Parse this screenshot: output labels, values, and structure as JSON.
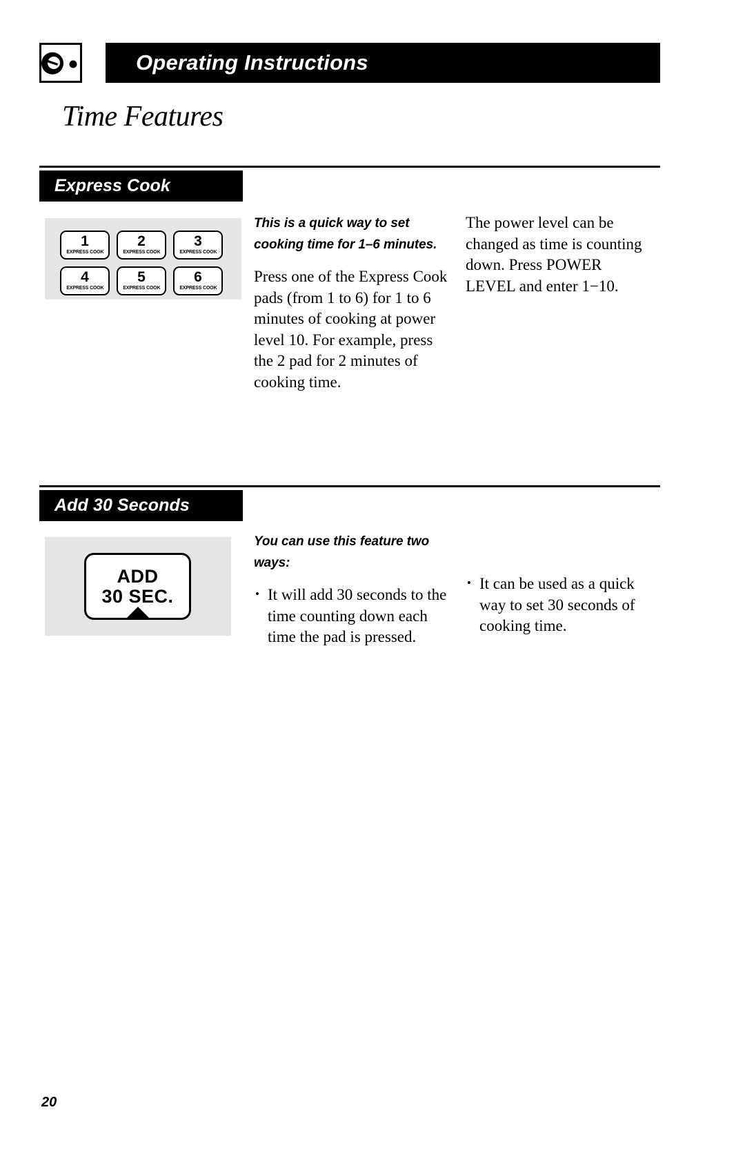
{
  "header": {
    "title": "Operating Instructions",
    "icon": "oven-dial-icon"
  },
  "page_title": "Time Features",
  "sections": [
    {
      "id": "express-cook",
      "label": "Express Cook",
      "art": {
        "type": "keypad-grid",
        "pads": [
          {
            "number": "1",
            "sublabel": "EXPRESS COOK"
          },
          {
            "number": "2",
            "sublabel": "EXPRESS COOK"
          },
          {
            "number": "3",
            "sublabel": "EXPRESS COOK"
          },
          {
            "number": "4",
            "sublabel": "EXPRESS COOK"
          },
          {
            "number": "5",
            "sublabel": "EXPRESS COOK"
          },
          {
            "number": "6",
            "sublabel": "EXPRESS COOK"
          }
        ]
      },
      "column_mid": {
        "lead": "This is a quick way to set cooking time for 1–6 minutes.",
        "body": "Press one of the Express Cook pads (from 1 to 6) for 1 to 6 minutes of cooking at power level 10. For example, press the 2 pad for 2 minutes of cooking time."
      },
      "column_right": {
        "body": "The power level can be changed as time is counting down. Press POWER LEVEL and enter 1−10."
      }
    },
    {
      "id": "add-30-seconds",
      "label": "Add 30 Seconds",
      "art": {
        "type": "add-30-pad",
        "pad_line1": "ADD",
        "pad_line2": "30 SEC.",
        "arrow": "triangle-up-icon"
      },
      "column_mid": {
        "lead": "You can use this feature two ways:",
        "bullets": [
          "It will add 30 seconds to the time counting down each time the pad is pressed."
        ]
      },
      "column_right": {
        "bullets": [
          "It can be used as a quick way to set 30 seconds of cooking time."
        ]
      }
    }
  ],
  "folio": "20"
}
